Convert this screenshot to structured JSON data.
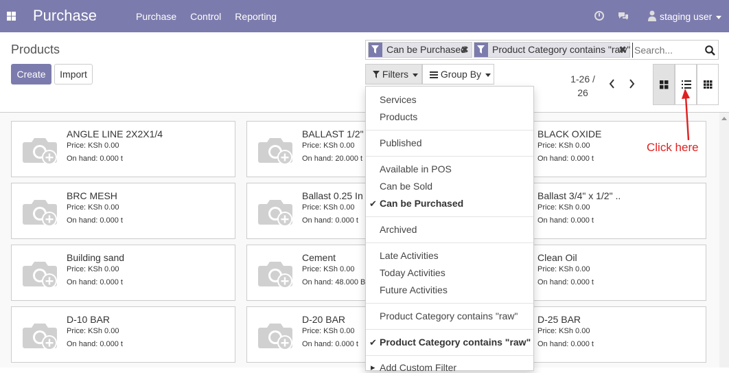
{
  "navbar": {
    "brand": "Purchase",
    "menu": [
      "Purchase",
      "Control",
      "Reporting"
    ],
    "user": "staging user"
  },
  "page": {
    "title": "Products",
    "create_label": "Create",
    "import_label": "Import"
  },
  "search": {
    "facets": [
      "Can be Purchased",
      "Product Category contains \"raw\""
    ],
    "placeholder": "Search..."
  },
  "toolbar": {
    "filters_label": "Filters",
    "groupby_label": "Group By",
    "pager_value": "1-26 /",
    "pager_total": "26"
  },
  "filters_menu": [
    {
      "label": "Services",
      "checked": false
    },
    {
      "label": "Products",
      "checked": false
    },
    {
      "label": "Published",
      "checked": false
    },
    {
      "label": "Available in POS",
      "checked": false
    },
    {
      "label": "Can be Sold",
      "checked": false
    },
    {
      "label": "Can be Purchased",
      "checked": true
    },
    {
      "label": "Archived",
      "checked": false
    },
    {
      "label": "Late Activities",
      "checked": false
    },
    {
      "label": "Today Activities",
      "checked": false
    },
    {
      "label": "Future Activities",
      "checked": false
    },
    {
      "label": "Product Category contains \"raw\"",
      "checked": false
    },
    {
      "label": "Product Category contains \"raw\"",
      "checked": true
    },
    {
      "label": "Add Custom Filter",
      "checked": false
    }
  ],
  "products": [
    {
      "name": "ANGLE LINE 2X2X1/4",
      "price": "Price: KSh 0.00",
      "onhand": "On hand: 0.000 t"
    },
    {
      "name": "BALLAST 1/2\"",
      "price": "Price: KSh 0.00",
      "onhand": "On hand: 20.000 t"
    },
    {
      "name": "BLACK OXIDE",
      "price": "Price: KSh 0.00",
      "onhand": "On hand: 0.000 t"
    },
    {
      "name": "BRC MESH",
      "price": "Price: KSh 0.00",
      "onhand": "On hand: 0.000 t"
    },
    {
      "name": "Ballast 0.25 In",
      "price": "Price: KSh 0.00",
      "onhand": "On hand: 0.000 t"
    },
    {
      "name": "Ballast 3/4\" x 1/2\" ..",
      "price": "Price: KSh 0.00",
      "onhand": "On hand: 0.000 t"
    },
    {
      "name": "Building sand",
      "price": "Price: KSh 0.00",
      "onhand": "On hand: 0.000 t"
    },
    {
      "name": "Cement",
      "price": "Price: KSh 0.00",
      "onhand": "On hand: 48.000 B"
    },
    {
      "name": "Clean Oil",
      "price": "Price: KSh 0.00",
      "onhand": "On hand: 0.000 t"
    },
    {
      "name": "D-10 BAR",
      "price": "Price: KSh 0.00",
      "onhand": "On hand: 0.000 t"
    },
    {
      "name": "D-20 BAR",
      "price": "Price: KSh 0.00",
      "onhand": "On hand: 0.000 t"
    },
    {
      "name": "D-25 BAR",
      "price": "Price: KSh 0.00",
      "onhand": "On hand: 0.000 t"
    }
  ],
  "annotation": {
    "text": "Click here"
  },
  "colors": {
    "brand": "#7c7bad",
    "annotation": "#e02020"
  }
}
